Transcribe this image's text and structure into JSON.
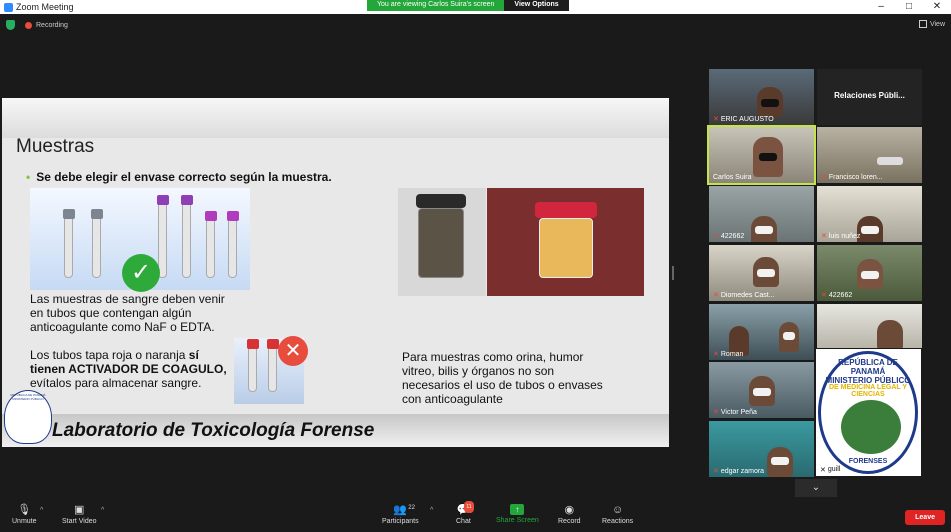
{
  "window": {
    "title": "Zoom Meeting"
  },
  "share_banner": {
    "text": "You are viewing Carlos Suira's screen",
    "options": "View Options"
  },
  "status": {
    "recording": "Recording",
    "view": "View"
  },
  "slide": {
    "title": "Muestras",
    "bullet": "Se debe elegir el envase correcto según la muestra.",
    "para1": [
      "Las muestras de sangre deben venir",
      "en tubos que contengan algún",
      "anticoagulante como NaF o EDTA."
    ],
    "para2_a": "Los tubos tapa roja o naranja ",
    "para2_b": "sí",
    "para2_c": "tienen ACTIVADOR DE COAGULO,",
    "para2_d": "evítalos para almacenar sangre.",
    "para3": [
      "Para muestras como orina, humor",
      "vitreo, bilis y órganos no son",
      "necesarios el uso de tubos o envases",
      "con anticoagulante"
    ],
    "footer": "Laboratorio de Toxicología Forense",
    "small_seal": "REPÚBLICA DE PANAMÁ MINISTERIO PÚBLICO"
  },
  "participants": [
    {
      "name": "ERIC AUGUSTO"
    },
    {
      "name": "Relaciones  Públi..."
    },
    {
      "name": "Carlos Suira"
    },
    {
      "name": "Francisco loren..."
    },
    {
      "name": "422662"
    },
    {
      "name": "luis nuñez"
    },
    {
      "name": "Diomedes Cast..."
    },
    {
      "name": "422662"
    },
    {
      "name": "Roman"
    },
    {
      "name": "Victor Peña"
    },
    {
      "name": "edgar zamora"
    },
    {
      "name": "guill"
    }
  ],
  "seal": {
    "top1": "REPÚBLICA DE PANAMÁ",
    "top2": "MINISTERIO PÚBLICO",
    "ring": "DE MEDICINA LEGAL Y CIENCIAS",
    "bottom": "FORENSES"
  },
  "toolbar": {
    "unmute": "Unmute",
    "start_video": "Start Video",
    "participants": "Participants",
    "participants_count": "22",
    "chat": "Chat",
    "chat_badge": "11",
    "share": "Share Screen",
    "record": "Record",
    "reactions": "Reactions",
    "leave": "Leave"
  },
  "colors": {
    "share_green": "#23a63a",
    "leave_red": "#e02424",
    "active_border": "#c7e34a"
  }
}
